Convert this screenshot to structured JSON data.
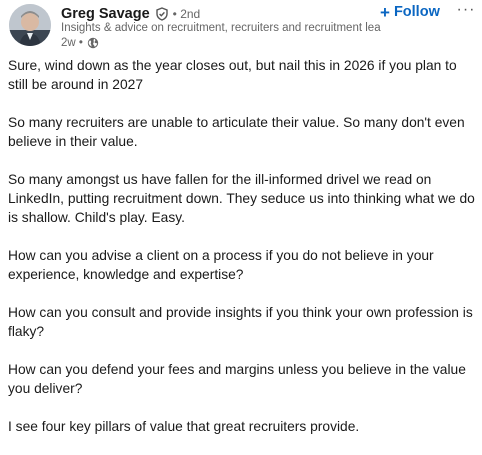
{
  "author": {
    "name": "Greg Savage",
    "degree": "• 2nd",
    "headline": "Insights & advice on recruitment, recruiters and recruitment lea...",
    "time": "2w •",
    "verified_icon": "verified-shield-icon",
    "visibility_icon": "globe-icon"
  },
  "actions": {
    "follow_label": "Follow",
    "follow_prefix": "+",
    "more_label": "···"
  },
  "colors": {
    "accent": "#0a66c2",
    "secondary_text": "#666666",
    "primary_text": "#1a1a1a"
  },
  "post": {
    "paragraphs": [
      "Sure, wind down as the year closes out, but nail this in 2026 if you plan to still be around in 2027",
      "So many recruiters are unable to articulate their value. So many don't even believe in their value.",
      "So many amongst us have fallen for the ill-informed drivel we read on LinkedIn, putting recruitment down. They seduce us into thinking what we do is shallow. Child's play. Easy.",
      "How can you advise a client on a process if you do not believe in your experience, knowledge and expertise?",
      "How can you consult and provide insights if you think your own profession is flaky?",
      "How can you defend your fees and margins unless you believe in the value you deliver?",
      "I see four key pillars of value that great recruiters provide."
    ]
  }
}
